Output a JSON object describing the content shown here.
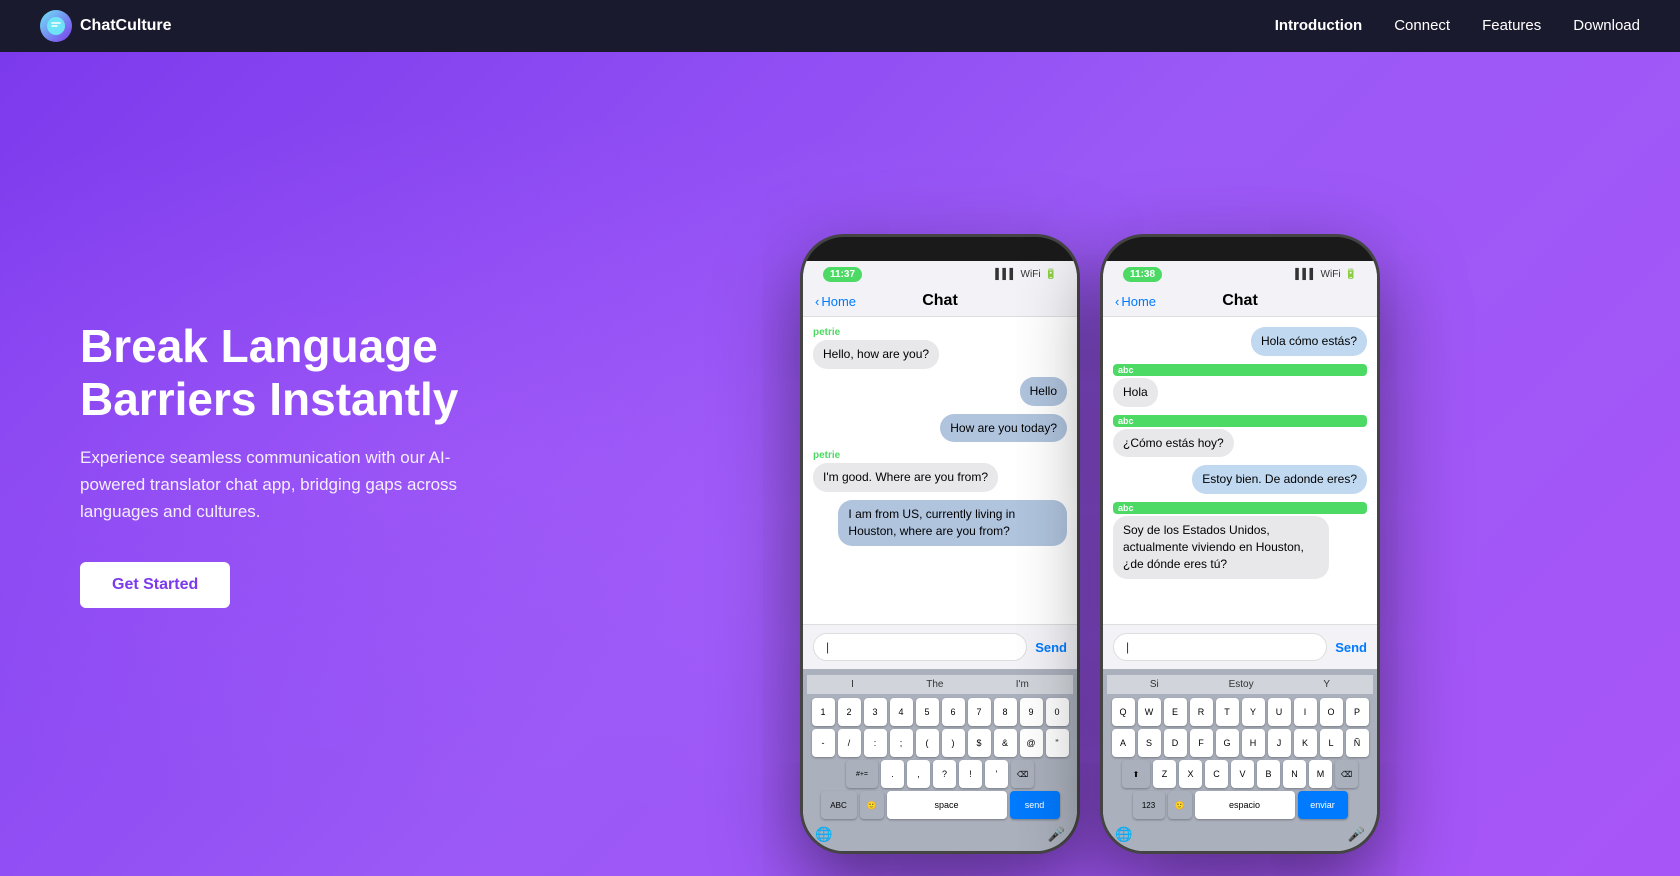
{
  "navbar": {
    "logo_text": "ChatCulture",
    "logo_icon": "C",
    "links": [
      {
        "label": "Introduction",
        "active": true
      },
      {
        "label": "Connect",
        "active": false
      },
      {
        "label": "Features",
        "active": false
      },
      {
        "label": "Download",
        "active": false
      }
    ]
  },
  "hero": {
    "title": "Break Language Barriers Instantly",
    "description": "Experience seamless communication with our AI-powered translator chat app, bridging gaps across languages and cultures.",
    "cta_label": "Get Started"
  },
  "phone1": {
    "time": "11:37",
    "nav_back": "Home",
    "nav_title": "Chat",
    "messages": [
      {
        "sender": "petrie",
        "text": "Hello, how are you?",
        "type": "received"
      },
      {
        "text": "Hello",
        "type": "sent"
      },
      {
        "text": "How are you today?",
        "type": "sent"
      },
      {
        "sender": "petrie",
        "text": "I'm good. Where are you from?",
        "type": "received"
      },
      {
        "text": "I am from US, currently living in Houston, where are you from?",
        "type": "sent"
      }
    ],
    "input_placeholder": "|",
    "send_label": "Send",
    "keyboard": {
      "suggestions": [
        "I",
        "The",
        "I'm"
      ],
      "rows": [
        [
          "1",
          "2",
          "3",
          "4",
          "5",
          "6",
          "7",
          "8",
          "9",
          "0"
        ],
        [
          "-",
          "/",
          ":",
          ";",
          "(",
          ")",
          "$",
          "&",
          "@",
          "\""
        ],
        [
          "#+=",
          ".",
          ",",
          "?",
          "!",
          "'",
          "⌫"
        ],
        [
          "ABC",
          "🙂",
          "space",
          "send"
        ]
      ]
    }
  },
  "phone2": {
    "time": "11:38",
    "nav_back": "Home",
    "nav_title": "Chat",
    "messages": [
      {
        "text": "Hola cómo estás?",
        "type": "sent-right"
      },
      {
        "sender": "abc",
        "text": "Hola",
        "type": "received"
      },
      {
        "sender": "abc",
        "text": "¿Cómo estás hoy?",
        "type": "received"
      },
      {
        "text": "Estoy bien. De adonde eres?",
        "type": "sent-right"
      },
      {
        "sender": "abc",
        "text": "Soy de los Estados Unidos, actualmente viviendo en Houston, ¿de dónde eres tú?",
        "type": "received"
      }
    ],
    "input_placeholder": "|",
    "send_label": "Send",
    "keyboard": {
      "suggestions": [
        "Si",
        "Estoy",
        "Y"
      ],
      "rows": [
        [
          "Q",
          "W",
          "E",
          "R",
          "T",
          "Y",
          "U",
          "I",
          "O",
          "P"
        ],
        [
          "A",
          "S",
          "D",
          "F",
          "G",
          "H",
          "J",
          "K",
          "L",
          "Ñ"
        ],
        [
          "⬆",
          "Z",
          "X",
          "C",
          "V",
          "B",
          "N",
          "M",
          "⌫"
        ],
        [
          "123",
          "🙂",
          "espacio",
          "enviar"
        ]
      ]
    }
  }
}
